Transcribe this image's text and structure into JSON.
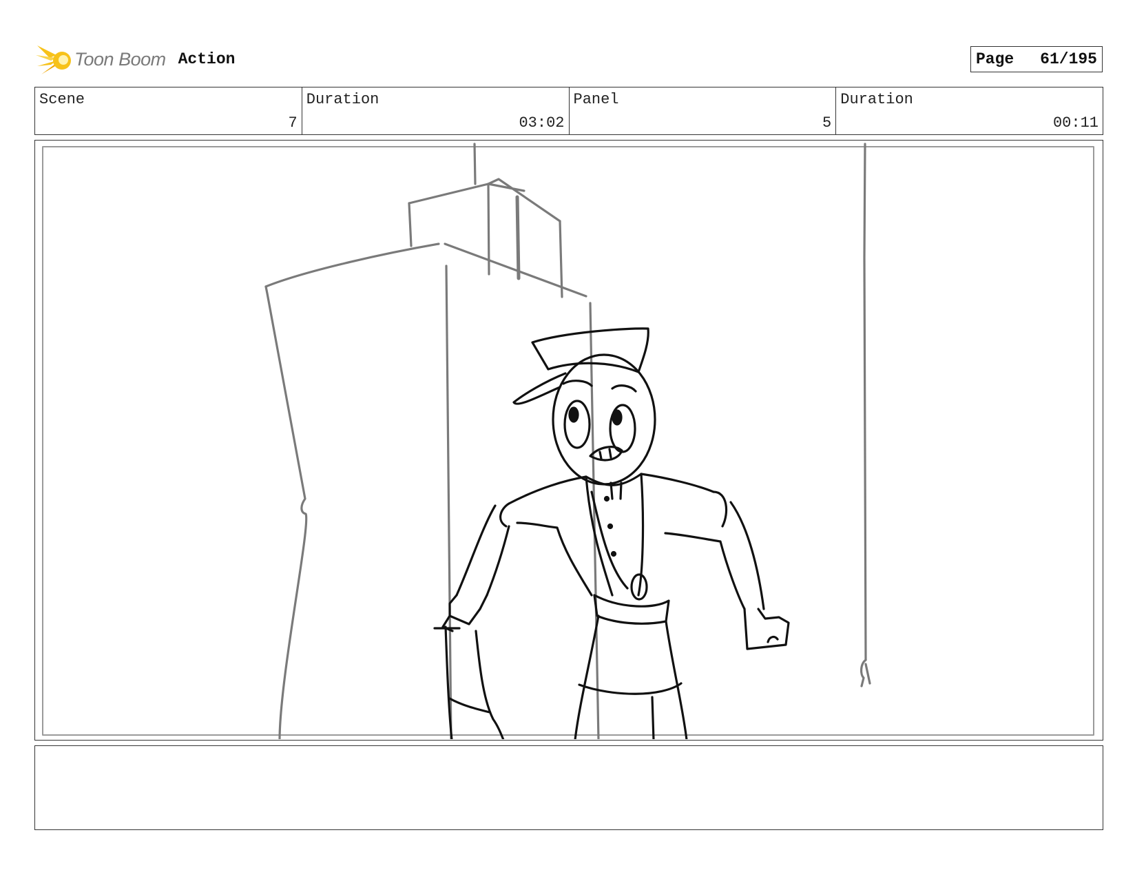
{
  "header": {
    "brand": "Toon Boom",
    "doc_title": "Action",
    "page_label": "Page",
    "page_value": "61/195"
  },
  "info": [
    {
      "label": "Scene",
      "value": "7"
    },
    {
      "label": "Duration",
      "value": "03:02"
    },
    {
      "label": "Panel",
      "value": "5"
    },
    {
      "label": "Duration",
      "value": "00:11"
    }
  ],
  "colors": {
    "logo_flame": "#f7c21a",
    "logo_flame_dark": "#f0a500",
    "sketch_background": "#7a7a7a",
    "sketch_character": "#111111"
  },
  "panel": {
    "image": "storyboard sketch",
    "notes": ""
  }
}
